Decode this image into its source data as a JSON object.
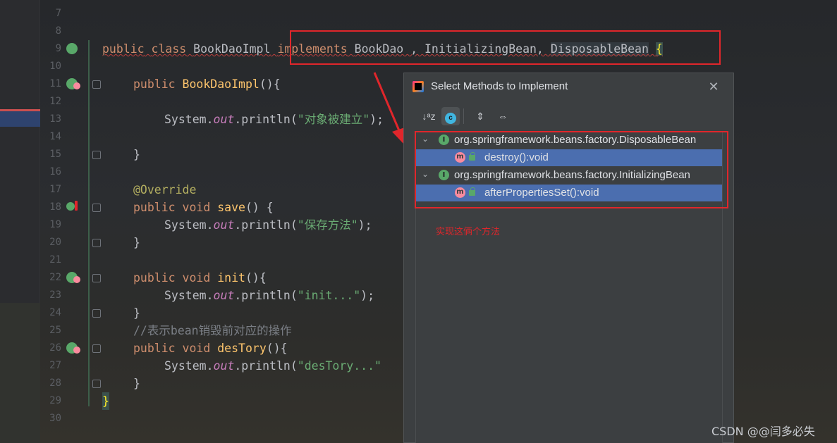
{
  "editor": {
    "lines": [
      {
        "num": "7"
      },
      {
        "num": "8"
      },
      {
        "num": "9"
      },
      {
        "num": "10"
      },
      {
        "num": "11"
      },
      {
        "num": "12"
      },
      {
        "num": "13"
      },
      {
        "num": "14"
      },
      {
        "num": "15"
      },
      {
        "num": "16"
      },
      {
        "num": "17"
      },
      {
        "num": "18"
      },
      {
        "num": "19"
      },
      {
        "num": "20"
      },
      {
        "num": "21"
      },
      {
        "num": "22"
      },
      {
        "num": "23"
      },
      {
        "num": "24"
      },
      {
        "num": "25"
      },
      {
        "num": "26"
      },
      {
        "num": "27"
      },
      {
        "num": "28"
      },
      {
        "num": "29"
      },
      {
        "num": "30"
      }
    ],
    "code": {
      "l9_public": "public",
      "l9_class": "class",
      "l9_name": "BookDaoImpl",
      "l9_implements": "implements",
      "l9_ifaces": "BookDao , InitializingBean, ",
      "l9_disposable": "DisposableBean",
      "l9_brace": "{",
      "l11_public": "public",
      "l11_ctor": "BookDaoImpl",
      "l11_rest": "(){",
      "l13_system": "System.",
      "l13_out": "out",
      "l13_println": ".println(",
      "l13_str": "\"对象被建立\"",
      "l13_end": ");",
      "l15": "}",
      "l17": "@Override",
      "l18_public": "public",
      "l18_void": "void",
      "l18_name": "save",
      "l18_rest": "() {",
      "l19_system": "System.",
      "l19_out": "out",
      "l19_println": ".println(",
      "l19_str": "\"保存方法\"",
      "l19_end": ");",
      "l20": "}",
      "l22_public": "public",
      "l22_void": "void",
      "l22_name": "init",
      "l22_rest": "(){",
      "l23_system": "System.",
      "l23_out": "out",
      "l23_println": ".println(",
      "l23_str": "\"init...\"",
      "l23_end": ");",
      "l24": "}",
      "l25": "//表示bean销毁前对应的操作",
      "l26_public": "public",
      "l26_void": "void",
      "l26_name": "desTory",
      "l26_rest": "(){",
      "l27_system": "System.",
      "l27_out": "out",
      "l27_println": ".println(",
      "l27_str": "\"desTory...\"",
      "l28": "}",
      "l29": "}"
    }
  },
  "dialog": {
    "title": "Select Methods to Implement",
    "close_label": "✕",
    "toolbar": {
      "sort_label": "↓ᵃz",
      "class_label": "c",
      "expand_label": "⇕",
      "collapse_label": "⇔"
    },
    "tree": [
      {
        "chevron": "⌄",
        "icon": "I",
        "label": "org.springframework.beans.factory.DisposableBean"
      },
      {
        "icon": "m",
        "label": "destroy():void"
      },
      {
        "chevron": "⌄",
        "icon": "I",
        "label": "org.springframework.beans.factory.InitializingBean"
      },
      {
        "icon": "m",
        "label": "afterPropertiesSet():void"
      }
    ]
  },
  "annotation": "实现这俩个方法",
  "watermark": "CSDN @@闫多必失",
  "colors": {
    "highlight_red": "#e0262b",
    "selection_blue": "#4b6eaf"
  }
}
